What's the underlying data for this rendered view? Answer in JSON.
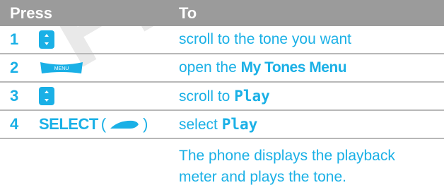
{
  "watermark": "PRE",
  "header": {
    "press": "Press",
    "to": "To"
  },
  "rows": [
    {
      "num": "1",
      "desc": "scroll to the tone you want"
    },
    {
      "num": "2",
      "key_label": "MENU",
      "desc_pre": "open the ",
      "desc_bold": "My Tones Menu"
    },
    {
      "num": "3",
      "desc_pre": "scroll to ",
      "desc_bold": "Play"
    },
    {
      "num": "4",
      "key_word": "SELECT",
      "key_open": "(",
      "key_close": ")",
      "desc_pre": "select ",
      "desc_bold": "Play"
    }
  ],
  "note_line1": "The phone displays the playback",
  "note_line2": "meter and plays the tone.",
  "colors": {
    "accent": "#1ab0e6",
    "header_bg": "#9b9b9b",
    "divider": "#b8b8b8"
  }
}
